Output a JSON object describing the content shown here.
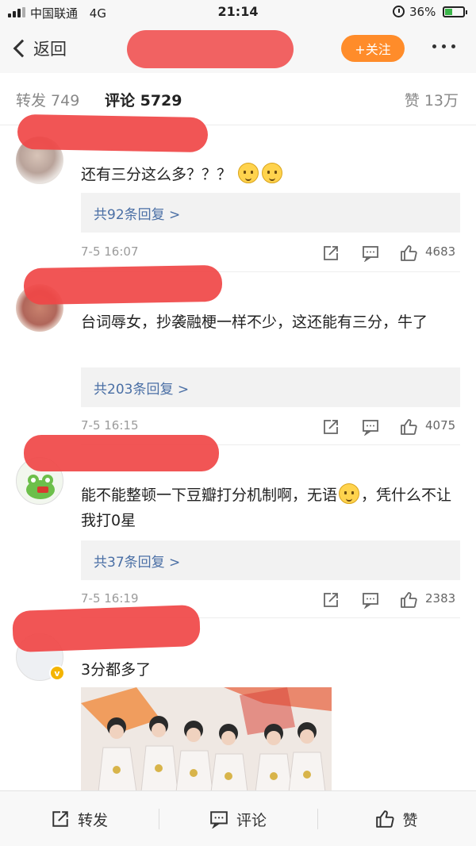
{
  "status_bar": {
    "carrier": "中国联通",
    "network": "4G",
    "time": "21:14",
    "battery": "36%"
  },
  "nav": {
    "back_label": "返回",
    "follow_label": "+关注",
    "more_icon": "more-icon"
  },
  "tabs": {
    "repost": "转发 749",
    "comments": "评论 5729",
    "likes": "赞 13万"
  },
  "comments": [
    {
      "text": "还有三分这么多？？？",
      "replies": "共92条回复 >",
      "time": "7-5 16:07",
      "likes": "4683"
    },
    {
      "text": "台词辱女，抄袭融梗一样不少，这还能有三分，牛了",
      "replies": "共203条回复 >",
      "time": "7-5 16:15",
      "likes": "4075"
    },
    {
      "text_a": "能不能整顿一下豆瓣打分机制啊，无语",
      "text_b": "，凭什么不让我打0星",
      "replies": "共37条回复 >",
      "time": "7-5 16:19",
      "likes": "2383"
    },
    {
      "text": "3分都多了"
    }
  ],
  "toolbar": {
    "repost": "转发",
    "comment": "评论",
    "like": "赞"
  },
  "colors": {
    "accent": "#ff8c2a",
    "link": "#4a6fa5",
    "redaction": "#f04646"
  }
}
